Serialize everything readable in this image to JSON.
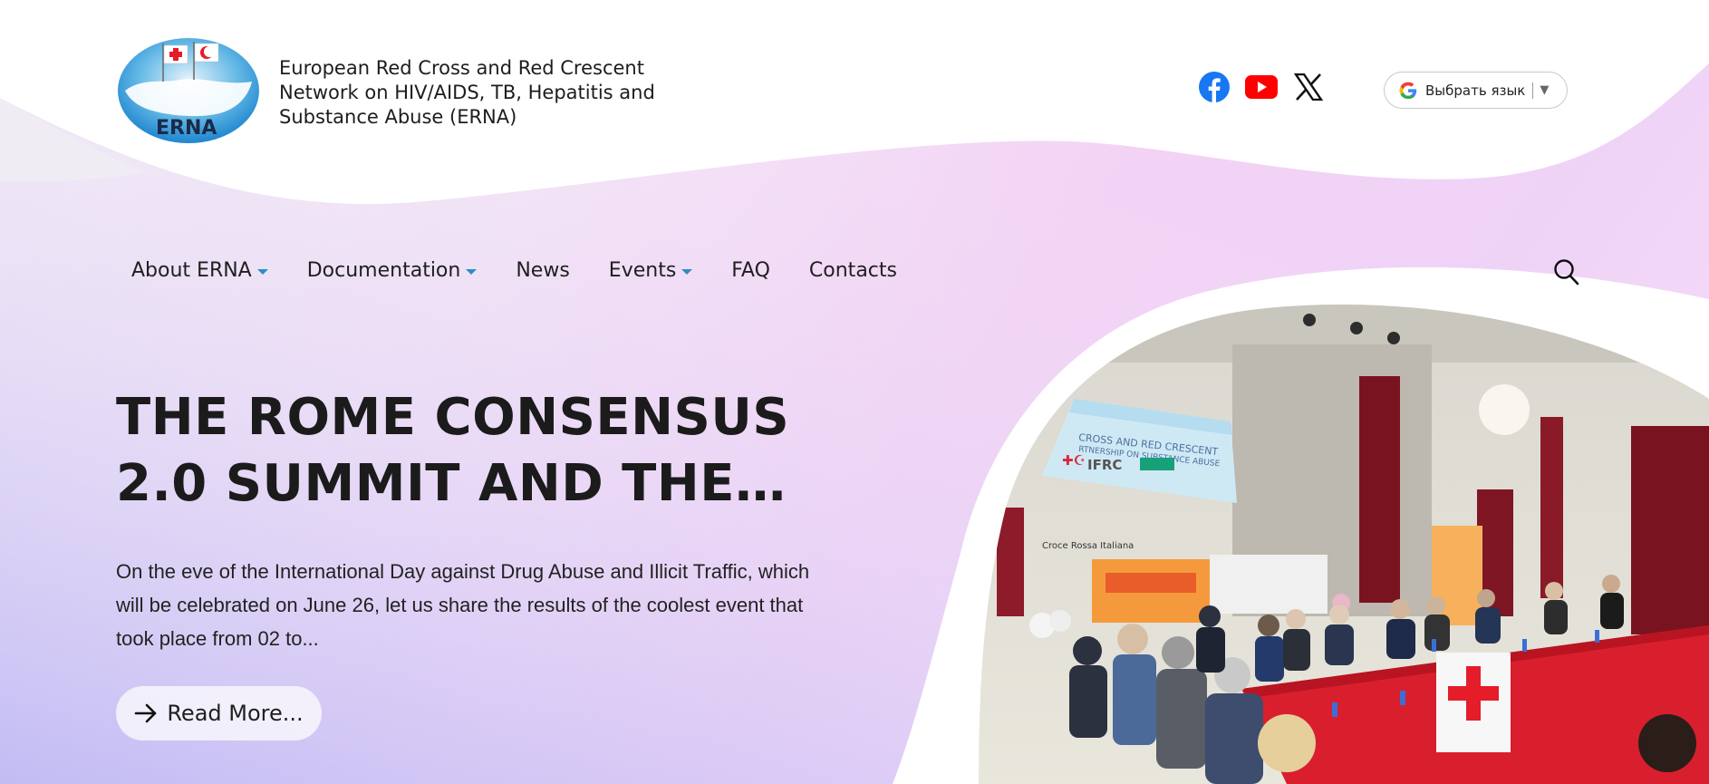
{
  "header": {
    "logo_label": "ERNA",
    "org_name": "European Red Cross and Red Crescent Network on HIV/AIDS, TB, Hepatitis and Substance Abuse (ERNA)",
    "socials": [
      {
        "icon": "facebook-icon"
      },
      {
        "icon": "youtube-icon"
      },
      {
        "icon": "x-icon"
      }
    ],
    "language": {
      "label": "Выбрать язык",
      "arrow": "▼"
    }
  },
  "nav": {
    "items": [
      {
        "label": "About ERNA",
        "dropdown": true
      },
      {
        "label": "Documentation",
        "dropdown": true
      },
      {
        "label": "News",
        "dropdown": false
      },
      {
        "label": "Events",
        "dropdown": true
      },
      {
        "label": "FAQ",
        "dropdown": false
      },
      {
        "label": "Contacts",
        "dropdown": false
      }
    ]
  },
  "hero": {
    "title": "THE ROME CONSENSUS 2.0 SUMMIT AND THE…",
    "text": "On the eve of the International Day against Drug Abuse and Illicit Traffic, which will be celebrated on June 26, let us share the results of the coolest event that took place from 02 to...",
    "read_more_label": "Read More...",
    "photo": {
      "screen_title": "CROSS AND RED CRESCENT RTNERSHIP ON SUBSTANCE ABUSE",
      "screen_logos": "IFRC",
      "caption": "Croce Rossa Italiana"
    }
  },
  "colors": {
    "accent": "#2a8fc7",
    "text": "#1b1b1b",
    "facebook": "#1877f2",
    "youtube": "#ff0000",
    "red_cross": "#e51c2a"
  }
}
